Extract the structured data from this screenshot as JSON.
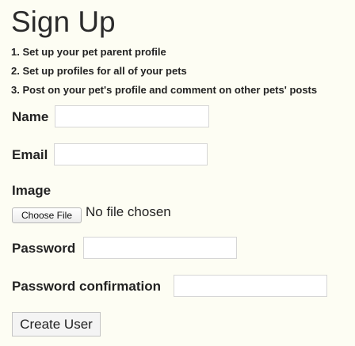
{
  "page": {
    "title": "Sign Up"
  },
  "steps": [
    "1. Set up your pet parent profile",
    "2. Set up profiles for all of your pets",
    "3. Post on your pet's profile and comment on other pets' posts"
  ],
  "form": {
    "name_label": "Name",
    "name_value": "",
    "email_label": "Email",
    "email_value": "",
    "image_label": "Image",
    "file_button_label": "Choose File",
    "file_status": "No file chosen",
    "password_label": "Password",
    "password_value": "",
    "password_confirmation_label": "Password confirmation",
    "password_confirmation_value": "",
    "submit_label": "Create User"
  }
}
